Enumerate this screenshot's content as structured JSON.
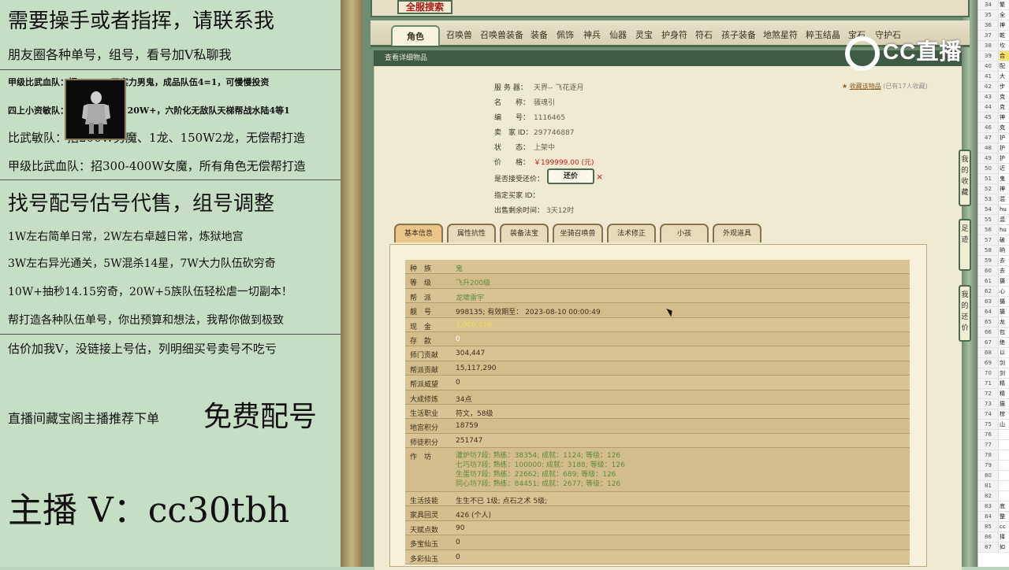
{
  "overlay": {
    "lines": [
      "需要操手或者指挥，请联系我",
      "朋友圈各种单号，组号，看号加V私聊我",
      "甲级比武血队：招50-200万实力男鬼，成品队伍4=1，可慢慢投资",
      "四上小资敏队：招3700男魔，20W+，六阶化无敌队天梯帮战水陆4等1",
      "比武敏队：招200W男魔、1龙、150W2龙，无偿帮打造",
      "甲级比武血队：招300-400W女魔，所有角色无偿帮打造",
      "找号配号估号代售，组号调整",
      "1W左右简单日常，2W左右卓越日常，炼狱地宫",
      "3W左右异光通关，5W混杀14星，7W大力队伍砍穷奇",
      "10W+抽秒14.15穷奇，20W+5族队伍轻松虐一切副本！",
      "帮打造各种队伍单号，你出预算和想法，我帮你做到极致",
      "估价加我V，没链接上号估，列明细买号卖号不吃亏",
      "直播间藏宝阁主播推荐下单",
      "免费配号",
      "主播 V：cc30tbh"
    ]
  },
  "game": {
    "logo": "全服搜索",
    "tabs": [
      "角色",
      "召唤兽",
      "召唤兽装备",
      "装备",
      "佩饰",
      "神兵",
      "仙器",
      "灵宝",
      "护身符",
      "符石",
      "孩子装备",
      "地煞星符",
      "粹玉结晶",
      "宝石",
      "守护石"
    ],
    "section_title": "查看详细物品",
    "info": [
      {
        "k": "服 务 器：",
        "v": "天界-- 飞花逐月"
      },
      {
        "k": "名　　称：",
        "v": "骚魂引"
      },
      {
        "k": "编　　号：",
        "v": "1116465"
      },
      {
        "k": "卖　家 ID：",
        "v": "297746887"
      },
      {
        "k": "状　　态：",
        "v": "上架中"
      },
      {
        "k": "价　　格：",
        "v": "￥199999.00 (元)"
      }
    ],
    "offer_label": "是否接受还价：",
    "offer_button": "还价",
    "offer_close": "×",
    "buyer_id_label": "指定买家 ID：",
    "remaining_label": "出售剩余时间：",
    "remaining_value": "3天12时",
    "favorite": "收藏该物品",
    "favorite_count": "(已有17人收藏)",
    "subtabs": [
      "基本信息",
      "属性抗性",
      "装备法宝",
      "坐骑召唤兽",
      "法术修正",
      "小孩",
      "外观道具"
    ],
    "rows": [
      {
        "k": "种　族",
        "v": "鬼",
        "cls": "g"
      },
      {
        "k": "等　级",
        "v": "飞升200级",
        "cls": "g"
      },
      {
        "k": "帮　派",
        "v": "龙啸雷宇",
        "cls": "g"
      },
      {
        "k": "靓　号",
        "v": "998135;  有效期至：  2023-08-10 00:00:49",
        "cls": ""
      },
      {
        "k": "现　金",
        "v": "1,000,116",
        "cls": "y"
      },
      {
        "k": "存　款",
        "v": "0",
        "cls": "w"
      },
      {
        "k": "师门贡献",
        "v": "304,447",
        "cls": ""
      },
      {
        "k": "帮派贡献",
        "v": "15,117,290",
        "cls": ""
      },
      {
        "k": "帮派威望",
        "v": "0",
        "cls": ""
      },
      {
        "k": "大成修炼",
        "v": "34点",
        "cls": ""
      },
      {
        "k": "生活职业",
        "v": "符文，58级",
        "cls": ""
      },
      {
        "k": "地宫积分",
        "v": "18759",
        "cls": ""
      },
      {
        "k": "师徒积分",
        "v": "251747",
        "cls": ""
      }
    ],
    "workshop_label": "作　坊",
    "workshop": [
      "灌炉坊7段; 熟练：38354; 成就：1124; 等级：126",
      "七巧坊7段; 熟练：100000; 成就：3188; 等级：126",
      "生蛋坊7段; 熟练：22662; 成就：689; 等级：126",
      "同心坊7段; 熟练：84451; 成就：2677; 等级：126"
    ],
    "rows2": [
      {
        "k": "生活技能",
        "v": "生生不已 1级; 点石之术 5级;"
      },
      {
        "k": "家具回灵",
        "v": "426 (个人)"
      },
      {
        "k": "天赋点数",
        "v": "90"
      },
      {
        "k": "多宝仙玉",
        "v": "0"
      },
      {
        "k": "多彩仙玉",
        "v": "0"
      }
    ],
    "side_buttons": [
      "我的收藏",
      "足迹",
      "我的还价"
    ]
  },
  "brand": "CC直播",
  "sheet": {
    "rows": [
      {
        "n": "34",
        "c": "繁"
      },
      {
        "n": "35",
        "c": "全"
      },
      {
        "n": "36",
        "c": "神"
      },
      {
        "n": "37",
        "c": "乾"
      },
      {
        "n": "38",
        "c": "坎"
      },
      {
        "n": "39",
        "c": "合"
      },
      {
        "n": "40",
        "c": "配"
      },
      {
        "n": "41",
        "c": "大"
      },
      {
        "n": "42",
        "c": "步"
      },
      {
        "n": "43",
        "c": "克"
      },
      {
        "n": "44",
        "c": "克"
      },
      {
        "n": "45",
        "c": "神"
      },
      {
        "n": "46",
        "c": "克"
      },
      {
        "n": "47",
        "c": "护"
      },
      {
        "n": "48",
        "c": "护"
      },
      {
        "n": "49",
        "c": "护"
      },
      {
        "n": "50",
        "c": "近"
      },
      {
        "n": "51",
        "c": "鬼"
      },
      {
        "n": "52",
        "c": "神"
      },
      {
        "n": "53",
        "c": "混"
      },
      {
        "n": "54",
        "c": "hu"
      },
      {
        "n": "55",
        "c": "混"
      },
      {
        "n": "56",
        "c": "hu"
      },
      {
        "n": "57",
        "c": "破"
      },
      {
        "n": "58",
        "c": "晌"
      },
      {
        "n": "59",
        "c": "去"
      },
      {
        "n": "60",
        "c": "去"
      },
      {
        "n": "61",
        "c": "摄"
      },
      {
        "n": "62",
        "c": "心"
      },
      {
        "n": "63",
        "c": "摄"
      },
      {
        "n": "64",
        "c": "摄"
      },
      {
        "n": "65",
        "c": "龙"
      },
      {
        "n": "66",
        "c": "包"
      },
      {
        "n": "67",
        "c": "绝"
      },
      {
        "n": "68",
        "c": "以"
      },
      {
        "n": "69",
        "c": "剑"
      },
      {
        "n": "70",
        "c": "剑"
      },
      {
        "n": "71",
        "c": "精"
      },
      {
        "n": "72",
        "c": "精"
      },
      {
        "n": "73",
        "c": "猫"
      },
      {
        "n": "74",
        "c": "棕"
      },
      {
        "n": "75",
        "c": "山"
      },
      {
        "n": "76",
        "c": ""
      },
      {
        "n": "77",
        "c": ""
      },
      {
        "n": "78",
        "c": ""
      },
      {
        "n": "79",
        "c": ""
      },
      {
        "n": "80",
        "c": ""
      },
      {
        "n": "81",
        "c": ""
      },
      {
        "n": "82",
        "c": ""
      },
      {
        "n": "83",
        "c": "底"
      },
      {
        "n": "84",
        "c": "整"
      },
      {
        "n": "85",
        "c": "cc"
      },
      {
        "n": "86",
        "c": "择"
      },
      {
        "n": "87",
        "c": "如"
      }
    ]
  }
}
